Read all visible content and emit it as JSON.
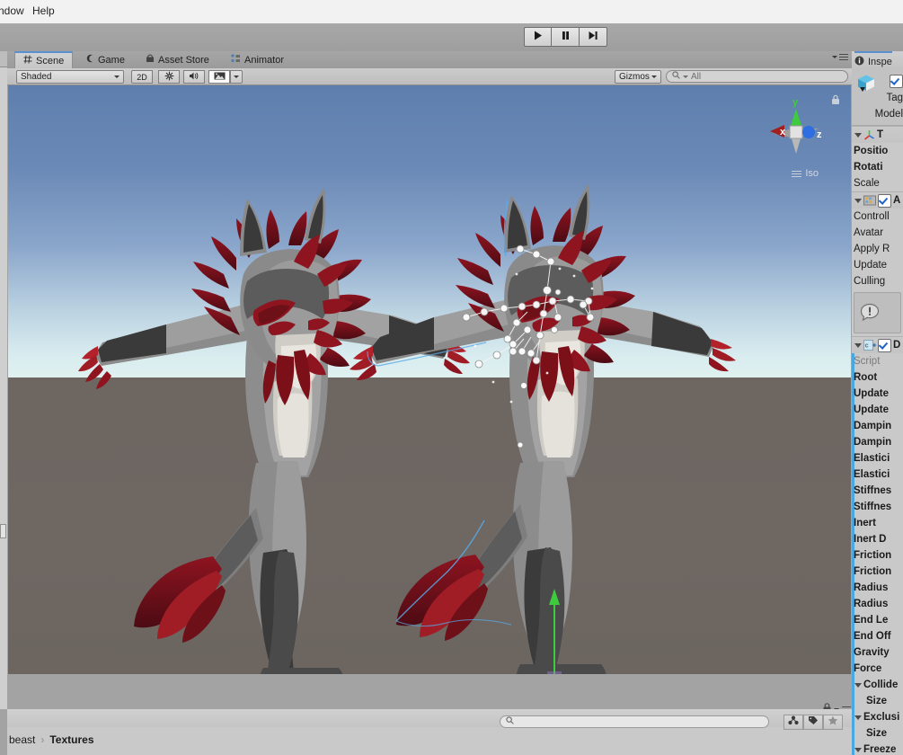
{
  "menubar": {
    "items": [
      "ndow",
      "Help"
    ]
  },
  "toolbar": {
    "play_icon": "play-icon",
    "pause_icon": "pause-icon",
    "step_icon": "step-icon"
  },
  "scene_dock": {
    "tabs": [
      {
        "label": "Scene",
        "icon": "grid-icon",
        "active": true
      },
      {
        "label": "Game",
        "icon": "gamepad-icon",
        "active": false
      },
      {
        "label": "Asset Store",
        "icon": "store-icon",
        "active": false
      },
      {
        "label": "Animator",
        "icon": "animator-icon",
        "active": false
      }
    ],
    "view_toolbar": {
      "draw_mode": "Shaded",
      "mode_2d": "2D",
      "lighting_icon": "sun-icon",
      "audio_icon": "speaker-icon",
      "effects_icon": "image-icon",
      "gizmos_label": "Gizmos",
      "search_placeholder": "All",
      "search_icon": "search-icon",
      "panel_menu_icon": "hamburger-icon"
    },
    "viewport": {
      "axis_labels": {
        "x": "x",
        "y": "y",
        "z": "z"
      },
      "projection_label": "Iso",
      "projection_icon": "hamburger-icon",
      "lock_icon": "lock-icon",
      "sky_top_color": "#5e7fae",
      "sky_horizon_color": "#dff0ef",
      "ground_color": "#6d6661",
      "character": {
        "fur_dark": "#3a3a3a",
        "fur_mid": "#8c8c8c",
        "fur_light": "#b9b9b9",
        "fur_cream": "#e2e0da",
        "mane_red": "#8e1420",
        "mane_red_dark": "#5e0d16",
        "claw_red": "#b3222b",
        "bone_color": "#ffffff",
        "gizmo_axis_y": "#3ecb3e",
        "gizmo_axis_x": "#e03030",
        "gizmo_axis_z": "#2e6ee0"
      }
    }
  },
  "project_dock": {
    "breadcrumb": [
      "beast",
      "Textures"
    ],
    "search_placeholder": "",
    "search_icon": "search-icon",
    "buttons": [
      "filter-type-icon",
      "filter-label-icon",
      "favorite-star-icon"
    ],
    "lock_icon": "lock-icon",
    "panel_menu_icon": "hamburger-icon"
  },
  "inspector": {
    "tab_label": "Inspe",
    "tab_icon": "info-icon",
    "header": {
      "object_icon": "prefab-cube-icon",
      "enabled": true,
      "tag_label": "Tag",
      "model_label": "Model"
    },
    "components": [
      {
        "name": "T",
        "icon": "transform-icon",
        "expanded": true,
        "rows": [
          {
            "label": "Positio",
            "bold": true
          },
          {
            "label": "Rotati",
            "bold": true
          },
          {
            "label": "Scale",
            "bold": false
          }
        ]
      },
      {
        "name": "A",
        "icon": "animator-icon",
        "expanded": true,
        "enabled": true,
        "rows": [
          {
            "label": "Controll",
            "bold": false
          },
          {
            "label": "Avatar",
            "bold": false
          },
          {
            "label": "Apply R",
            "bold": false
          },
          {
            "label": "Update",
            "bold": false
          },
          {
            "label": "Culling",
            "bold": false
          }
        ],
        "helpbox": {
          "icon": "warning-icon"
        }
      },
      {
        "name": "D",
        "icon": "script-icon",
        "expanded": true,
        "enabled": true,
        "rows": [
          {
            "label": "Script",
            "bold": false,
            "dim": true
          },
          {
            "label": "Root",
            "bold": true
          },
          {
            "label": "Update",
            "bold": true
          },
          {
            "label": "Update",
            "bold": true
          },
          {
            "label": "Dampin",
            "bold": true
          },
          {
            "label": "Dampin",
            "bold": true
          },
          {
            "label": "Elastici",
            "bold": true
          },
          {
            "label": "Elastici",
            "bold": true
          },
          {
            "label": "Stiffnes",
            "bold": true
          },
          {
            "label": "Stiffnes",
            "bold": true
          },
          {
            "label": "Inert",
            "bold": true
          },
          {
            "label": "Inert D",
            "bold": true
          },
          {
            "label": "Friction",
            "bold": true
          },
          {
            "label": "Friction",
            "bold": true
          },
          {
            "label": "Radius",
            "bold": true
          },
          {
            "label": "Radius",
            "bold": true
          },
          {
            "label": "End Le",
            "bold": true
          },
          {
            "label": "End Off",
            "bold": true
          },
          {
            "label": "Gravity",
            "bold": true
          },
          {
            "label": "Force",
            "bold": true
          },
          {
            "label": "Collide",
            "bold": true,
            "foldout": true
          },
          {
            "label": "Size",
            "bold": true,
            "indent": true
          },
          {
            "label": "Exclusi",
            "bold": true,
            "foldout": true
          },
          {
            "label": "Size",
            "bold": true,
            "indent": true
          },
          {
            "label": "Freeze",
            "bold": true,
            "foldout": true
          }
        ]
      }
    ]
  }
}
